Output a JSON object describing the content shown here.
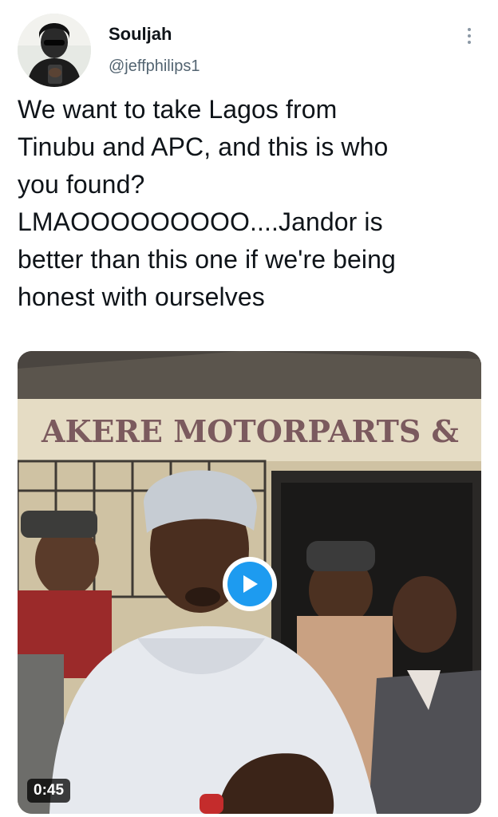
{
  "tweet": {
    "author": {
      "display_name": "Souljah",
      "handle": "@jeffphilips1"
    },
    "text": "We want to take Lagos from\nTinubu and APC, and this is who\nyou found?\nLMAOOOOOOOOO....Jandor is\nbetter than this one if we're being\nhonest with ourselves",
    "media": {
      "type": "video",
      "duration": "0:45",
      "sign_text": "AKERE MOTORPARTS &"
    }
  },
  "colors": {
    "text": "#0f1419",
    "secondary": "#536471",
    "accent": "#1d9bf0"
  },
  "icons": {
    "more": "more-vertical-icon",
    "play": "play-icon"
  }
}
